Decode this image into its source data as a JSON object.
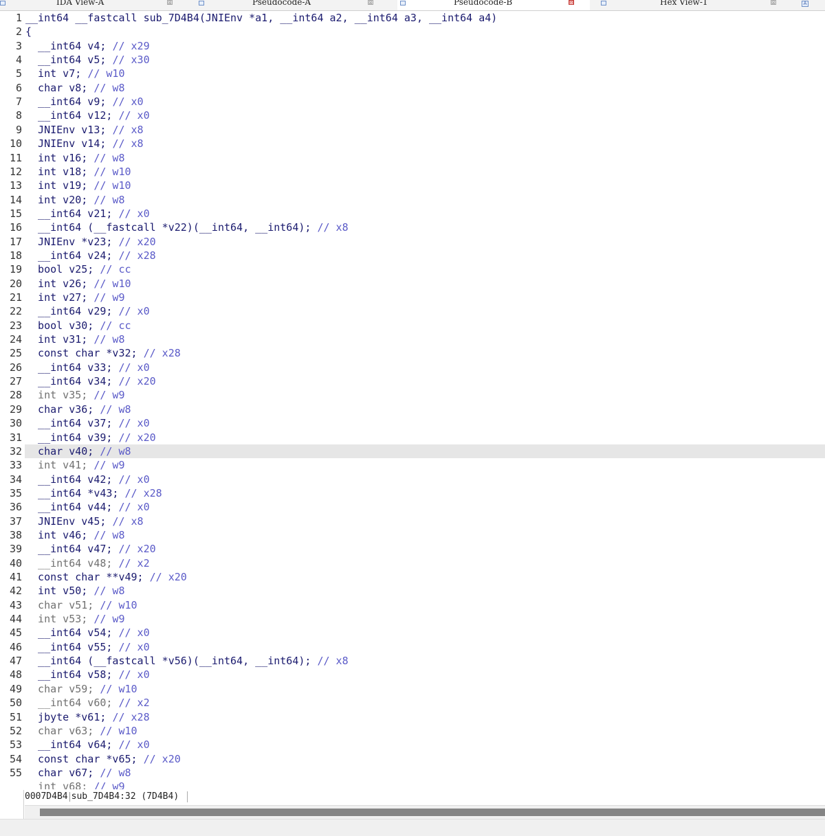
{
  "tabs": [
    {
      "title": "IDA View-A",
      "active": false
    },
    {
      "title": "Pseudocode-A",
      "active": false
    },
    {
      "title": "Pseudocode-B",
      "active": true
    },
    {
      "title": "Hex View-1",
      "active": false
    }
  ],
  "tab_close_symbol": "⊠",
  "tab_extra_label": "A",
  "highlighted_line": 32,
  "code_lines": [
    {
      "n": "1",
      "decl": "__int64 __fastcall sub_7D4B4(JNIEnv *a1, __int64 a2, __int64 a3, __int64 a4)",
      "cmt": "",
      "dim": false
    },
    {
      "n": "2",
      "decl": "{",
      "cmt": "",
      "dim": false
    },
    {
      "n": "3",
      "decl": "  __int64 v4; ",
      "cmt": "// x29",
      "dim": false
    },
    {
      "n": "4",
      "decl": "  __int64 v5; ",
      "cmt": "// x30",
      "dim": false
    },
    {
      "n": "5",
      "decl": "  int v7; ",
      "cmt": "// w10",
      "dim": false
    },
    {
      "n": "6",
      "decl": "  char v8; ",
      "cmt": "// w8",
      "dim": false
    },
    {
      "n": "7",
      "decl": "  __int64 v9; ",
      "cmt": "// x0",
      "dim": false
    },
    {
      "n": "8",
      "decl": "  __int64 v12; ",
      "cmt": "// x0",
      "dim": false
    },
    {
      "n": "9",
      "decl": "  JNIEnv v13; ",
      "cmt": "// x8",
      "dim": false
    },
    {
      "n": "10",
      "decl": "  JNIEnv v14; ",
      "cmt": "// x8",
      "dim": false
    },
    {
      "n": "11",
      "decl": "  int v16; ",
      "cmt": "// w8",
      "dim": false
    },
    {
      "n": "12",
      "decl": "  int v18; ",
      "cmt": "// w10",
      "dim": false
    },
    {
      "n": "13",
      "decl": "  int v19; ",
      "cmt": "// w10",
      "dim": false
    },
    {
      "n": "14",
      "decl": "  int v20; ",
      "cmt": "// w8",
      "dim": false
    },
    {
      "n": "15",
      "decl": "  __int64 v21; ",
      "cmt": "// x0",
      "dim": false
    },
    {
      "n": "16",
      "decl": "  __int64 (__fastcall *v22)(__int64, __int64); ",
      "cmt": "// x8",
      "dim": false
    },
    {
      "n": "17",
      "decl": "  JNIEnv *v23; ",
      "cmt": "// x20",
      "dim": false
    },
    {
      "n": "18",
      "decl": "  __int64 v24; ",
      "cmt": "// x28",
      "dim": false
    },
    {
      "n": "19",
      "decl": "  bool v25; ",
      "cmt": "// cc",
      "dim": false
    },
    {
      "n": "20",
      "decl": "  int v26; ",
      "cmt": "// w10",
      "dim": false
    },
    {
      "n": "21",
      "decl": "  int v27; ",
      "cmt": "// w9",
      "dim": false
    },
    {
      "n": "22",
      "decl": "  __int64 v29; ",
      "cmt": "// x0",
      "dim": false
    },
    {
      "n": "23",
      "decl": "  bool v30; ",
      "cmt": "// cc",
      "dim": false
    },
    {
      "n": "24",
      "decl": "  int v31; ",
      "cmt": "// w8",
      "dim": false
    },
    {
      "n": "25",
      "decl": "  const char *v32; ",
      "cmt": "// x28",
      "dim": false
    },
    {
      "n": "26",
      "decl": "  __int64 v33; ",
      "cmt": "// x0",
      "dim": false
    },
    {
      "n": "27",
      "decl": "  __int64 v34; ",
      "cmt": "// x20",
      "dim": false
    },
    {
      "n": "28",
      "decl": "  int v35; ",
      "cmt": "// w9",
      "dim": true
    },
    {
      "n": "29",
      "decl": "  char v36; ",
      "cmt": "// w8",
      "dim": false
    },
    {
      "n": "30",
      "decl": "  __int64 v37; ",
      "cmt": "// x0",
      "dim": false
    },
    {
      "n": "31",
      "decl": "  __int64 v39; ",
      "cmt": "// x20",
      "dim": false
    },
    {
      "n": "32",
      "decl": "  char v40; ",
      "cmt": "// w8",
      "dim": false
    },
    {
      "n": "33",
      "decl": "  int v41; ",
      "cmt": "// w9",
      "dim": true
    },
    {
      "n": "34",
      "decl": "  __int64 v42; ",
      "cmt": "// x0",
      "dim": false
    },
    {
      "n": "35",
      "decl": "  __int64 *v43; ",
      "cmt": "// x28",
      "dim": false
    },
    {
      "n": "36",
      "decl": "  __int64 v44; ",
      "cmt": "// x0",
      "dim": false
    },
    {
      "n": "37",
      "decl": "  JNIEnv v45; ",
      "cmt": "// x8",
      "dim": false
    },
    {
      "n": "38",
      "decl": "  int v46; ",
      "cmt": "// w8",
      "dim": false
    },
    {
      "n": "39",
      "decl": "  __int64 v47; ",
      "cmt": "// x20",
      "dim": false
    },
    {
      "n": "40",
      "decl": "  __int64 v48; ",
      "cmt": "// x2",
      "dim": true
    },
    {
      "n": "41",
      "decl": "  const char **v49; ",
      "cmt": "// x20",
      "dim": false
    },
    {
      "n": "42",
      "decl": "  int v50; ",
      "cmt": "// w8",
      "dim": false
    },
    {
      "n": "43",
      "decl": "  char v51; ",
      "cmt": "// w10",
      "dim": true
    },
    {
      "n": "44",
      "decl": "  int v53; ",
      "cmt": "// w9",
      "dim": true
    },
    {
      "n": "45",
      "decl": "  __int64 v54; ",
      "cmt": "// x0",
      "dim": false
    },
    {
      "n": "46",
      "decl": "  __int64 v55; ",
      "cmt": "// x0",
      "dim": false
    },
    {
      "n": "47",
      "decl": "  __int64 (__fastcall *v56)(__int64, __int64); ",
      "cmt": "// x8",
      "dim": false
    },
    {
      "n": "48",
      "decl": "  __int64 v58; ",
      "cmt": "// x0",
      "dim": false
    },
    {
      "n": "49",
      "decl": "  char v59; ",
      "cmt": "// w10",
      "dim": true
    },
    {
      "n": "50",
      "decl": "  __int64 v60; ",
      "cmt": "// x2",
      "dim": true
    },
    {
      "n": "51",
      "decl": "  jbyte *v61; ",
      "cmt": "// x28",
      "dim": false
    },
    {
      "n": "52",
      "decl": "  char v63; ",
      "cmt": "// w10",
      "dim": true
    },
    {
      "n": "53",
      "decl": "  __int64 v64; ",
      "cmt": "// x0",
      "dim": false
    },
    {
      "n": "54",
      "decl": "  const char *v65; ",
      "cmt": "// x20",
      "dim": false
    },
    {
      "n": "55",
      "decl": "  char v67; ",
      "cmt": "// w8",
      "dim": false
    },
    {
      "n": "",
      "decl": "  int v68; ",
      "cmt": "// w9",
      "dim": true
    }
  ],
  "status": {
    "address": "0007D4B4",
    "location": "sub_7D4B4:32",
    "offset": "(7D4B4)"
  }
}
